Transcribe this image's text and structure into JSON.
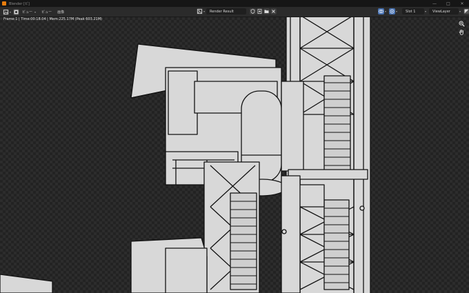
{
  "window": {
    "title": "Blender [ビ]"
  },
  "header": {
    "menus": [
      "ビュー",
      "ビュー",
      "画像"
    ],
    "render_result_label": "Render Result",
    "slot_label": "Slot 1",
    "view_layer_label": "ViewLayer"
  },
  "viewport": {
    "stats": "Frame:1 | Time:00:18.04 | Mem:225.17M (Peak 603.21M)"
  },
  "icons": {
    "editor_type": "image-editor-icon",
    "browse_image": "image-icon",
    "fake_user": "shield-icon",
    "new_image": "new-image-icon",
    "open_image": "folder-icon",
    "unlink": "close-icon",
    "display_channels": "rgb-channels-icon",
    "zoom": "zoom-icon",
    "pan": "hand-icon"
  },
  "colors": {
    "header_bg": "#2b2b2b",
    "accent_blue": "#4772b3",
    "model_fill": "#d8d8d8"
  }
}
